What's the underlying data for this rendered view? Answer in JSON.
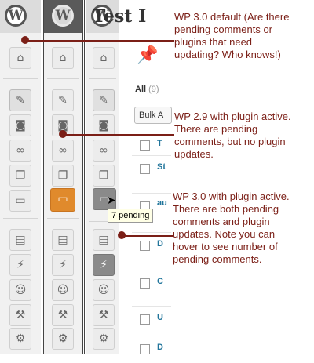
{
  "site_title": "Test I",
  "list": {
    "all_label": "All",
    "all_count": "(9)",
    "bulk_actions": "Bulk A",
    "row_initials": [
      "T",
      "St",
      "",
      "au",
      "D",
      "C",
      "U",
      "D"
    ]
  },
  "tooltip": "7 pending",
  "annotations": [
    {
      "text": "WP 3.0 default (Are there pending comments or plugins that need updating? Who knows!)"
    },
    {
      "text": "WP 2.9 with plugin active. There are pending comments, but no plugin updates."
    },
    {
      "text": "WP 3.0 with plugin active. There are both pending comments and plugin updates. Note you can hover to see number of pending comments."
    }
  ],
  "colors": {
    "annotation": "#7b1f17",
    "orange_badge": "#e08a2c",
    "link": "#21759b"
  },
  "menu_icons": [
    "dashboard-icon",
    "pin-icon",
    "media-icon",
    "links-icon",
    "pages-icon",
    "comments-icon",
    "appearance-icon",
    "plugins-icon",
    "users-icon",
    "tools-icon",
    "settings-icon"
  ]
}
